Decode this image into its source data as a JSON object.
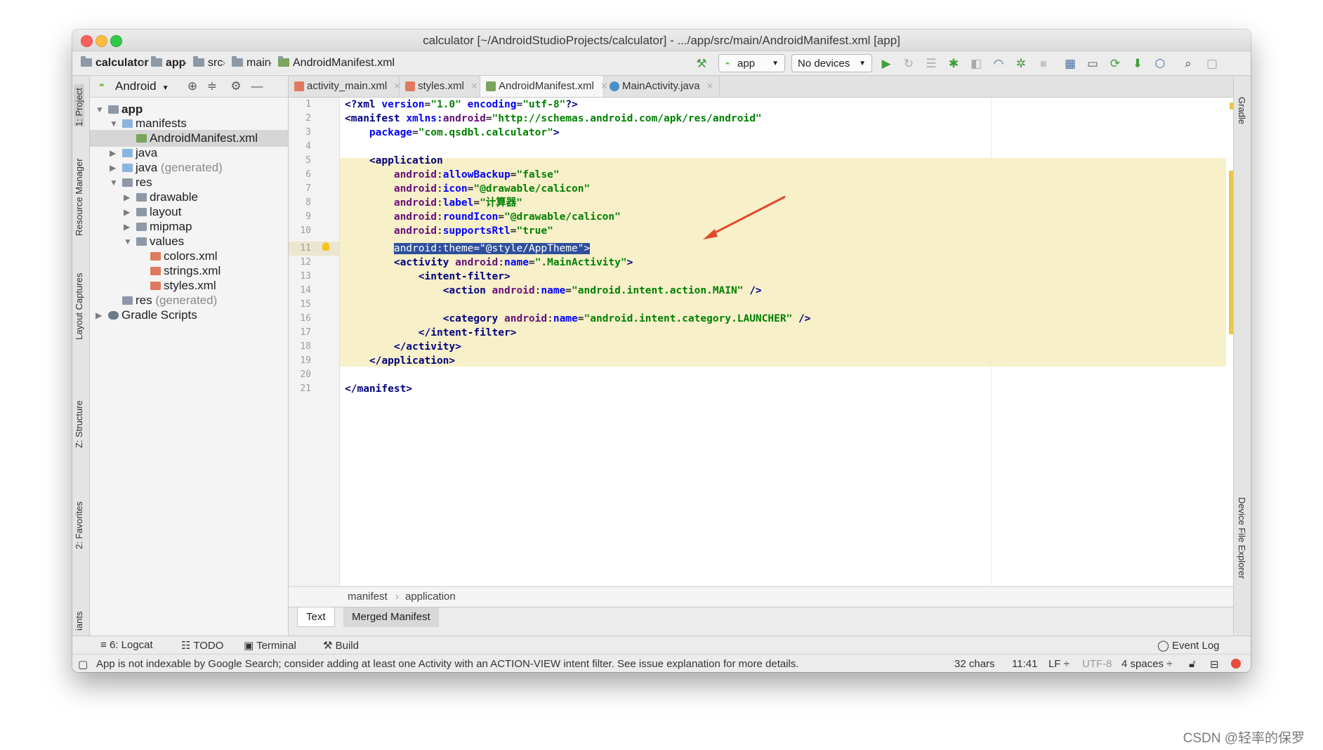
{
  "window": {
    "title": "calculator [~/AndroidStudioProjects/calculator] - .../app/src/main/AndroidManifest.xml [app]"
  },
  "navbar": {
    "breadcrumbs": [
      "calculator",
      "app",
      "src",
      "main",
      "AndroidManifest.xml"
    ],
    "run_config": "app",
    "device": "No devices"
  },
  "left_stripe": {
    "tabs": [
      "1: Project",
      "Resource Manager",
      "Layout Captures",
      "Z: Structure",
      "2: Favorites",
      "iants"
    ]
  },
  "right_stripe": {
    "tabs": [
      "Gradle",
      "Device File Explorer"
    ]
  },
  "project": {
    "view_mode": "Android",
    "tree": [
      {
        "label": "app",
        "bold": true
      },
      {
        "label": "manifests"
      },
      {
        "label": "AndroidManifest.xml",
        "selected": true
      },
      {
        "label": "java"
      },
      {
        "label": "java",
        "suffix": "(generated)"
      },
      {
        "label": "res"
      },
      {
        "label": "drawable"
      },
      {
        "label": "layout"
      },
      {
        "label": "mipmap"
      },
      {
        "label": "values"
      },
      {
        "label": "colors.xml"
      },
      {
        "label": "strings.xml"
      },
      {
        "label": "styles.xml"
      },
      {
        "label": "res",
        "suffix": "(generated)"
      },
      {
        "label": "Gradle Scripts"
      }
    ]
  },
  "tabs": [
    "activity_main.xml",
    "styles.xml",
    "AndroidManifest.xml",
    "MainActivity.java"
  ],
  "editor": {
    "line_numbers": [
      "1",
      "2",
      "3",
      "4",
      "5",
      "6",
      "7",
      "8",
      "9",
      "10",
      "11",
      "12",
      "13",
      "14",
      "15",
      "16",
      "17",
      "18",
      "19",
      "20",
      "21"
    ],
    "selected_text": "android:theme=\"@style/AppTheme\">"
  },
  "breadcrumb_bar": {
    "items": [
      "manifest",
      "application"
    ]
  },
  "bottom_tabs": [
    "Text",
    "Merged Manifest"
  ],
  "tool_windows": {
    "logcat": "6: Logcat",
    "todo": "TODO",
    "terminal": "Terminal",
    "build": "Build",
    "event_log": "Event Log"
  },
  "status": {
    "message": "App is not indexable by Google Search; consider adding at least one Activity with an ACTION-VIEW intent filter. See issue explanation for more details.",
    "chars": "32 chars",
    "position": "11:41",
    "line_sep": "LF ÷",
    "encoding": "UTF-8",
    "indent": "4 spaces ÷"
  },
  "watermark": "CSDN @轻率的保罗",
  "colors": {
    "highlight_band": "#f7f0c9",
    "selection": "#2e4f9c",
    "annotation_arrow": "#e24a2b"
  }
}
